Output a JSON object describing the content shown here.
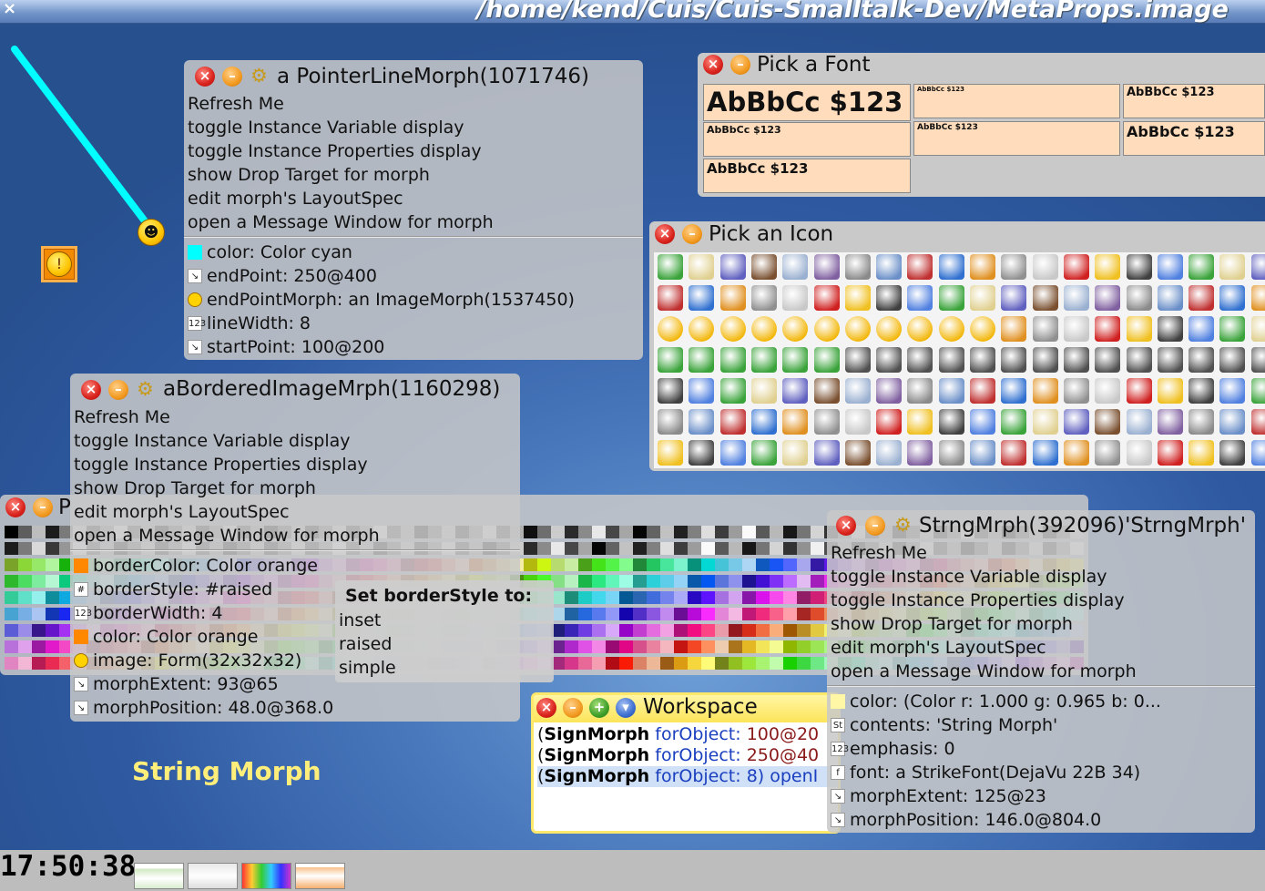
{
  "titlebar": {
    "close_glyph": "×",
    "path": "/home/kend/Cuis/Cuis-Smalltalk-Dev/MetaProps.image"
  },
  "pointer_win": {
    "title": "a PointerLineMorph(1071746)",
    "menu": [
      "Refresh Me",
      "toggle Instance Variable display",
      "toggle Instance Properties display",
      "show Drop Target for morph",
      "edit morph's LayoutSpec",
      "open a Message Window for morph"
    ],
    "props": [
      {
        "icon": "color-swatch",
        "text": "color:  Color cyan"
      },
      {
        "icon": "point-icon",
        "text": "endPoint:  250@400"
      },
      {
        "icon": "smiley-icon",
        "text": "endPointMorph:  an ImageMorph(1537450)"
      },
      {
        "icon": "number-icon",
        "text": "lineWidth:  8"
      },
      {
        "icon": "point-icon",
        "text": "startPoint:  100@200"
      }
    ]
  },
  "bordered_win": {
    "title": "aBorderedImageMrph(1160298)",
    "menu": [
      "Refresh Me",
      "toggle Instance Variable display",
      "toggle Instance Properties display",
      "show Drop Target for morph",
      "edit morph's LayoutSpec",
      "open a Message Window for morph"
    ],
    "props": [
      {
        "icon": "color-swatch",
        "text": "borderColor:  Color orange"
      },
      {
        "icon": "symbol-icon",
        "text": "borderStyle:  #raised"
      },
      {
        "icon": "number-icon",
        "text": "borderWidth:  4"
      },
      {
        "icon": "color-swatch",
        "text": "color:  Color orange"
      },
      {
        "icon": "smiley-icon",
        "text": "image:  Form(32x32x32)"
      },
      {
        "icon": "point-icon",
        "text": "morphExtent:  93@65"
      },
      {
        "icon": "point-icon",
        "text": "morphPosition:  48.0@368.0"
      }
    ]
  },
  "string_win": {
    "title": "StrngMrph(392096)'StrngMrph'",
    "menu": [
      "Refresh Me",
      "toggle Instance Variable display",
      "toggle Instance Properties display",
      "show Drop Target for morph",
      "edit morph's LayoutSpec",
      "open a Message Window for morph"
    ],
    "props": [
      {
        "icon": "color-swatch",
        "text": "color:  (Color r: 1.000 g: 0.965 b: 0..."
      },
      {
        "icon": "string-icon",
        "text": "contents:  'String Morph'"
      },
      {
        "icon": "number-icon",
        "text": "emphasis:  0"
      },
      {
        "icon": "font-icon",
        "text": "font:  a StrikeFont(DejaVu 22B 34)"
      },
      {
        "icon": "point-icon",
        "text": "morphExtent:  125@23"
      },
      {
        "icon": "point-icon",
        "text": "morphPosition:  146.0@804.0"
      }
    ]
  },
  "font_win": {
    "title": "Pick a Font",
    "samples": [
      "AbBbCc $123",
      "AbBbCc $123",
      "AbBbCc $123",
      "AbBbCc $123",
      "AbBbCc $123",
      "AbBbCc $123",
      "AbBbCc $123"
    ]
  },
  "icon_win": {
    "title": "Pick an Icon"
  },
  "palette_win": {
    "title_partial": "P"
  },
  "borderstyle_menu": {
    "heading": "Set borderStyle to:",
    "options": [
      "inset",
      "raised",
      "simple"
    ]
  },
  "workspace": {
    "title": "Workspace",
    "lines": [
      {
        "cls": "SignMorph",
        "sel": "forObject:",
        "arg": "100@20"
      },
      {
        "cls": "SignMorph",
        "sel": "forObject:",
        "arg": "250@40"
      },
      {
        "cls": "SignMorph",
        "sel": "forObject:",
        "arg": "8) openI"
      }
    ]
  },
  "string_morph": {
    "text": "String Morph"
  },
  "taskbar": {
    "clock": "17:50:38"
  },
  "colors": {
    "cyan": "#00ffff",
    "orange": "#ff8800",
    "string_yellow": "#ffef7a"
  }
}
